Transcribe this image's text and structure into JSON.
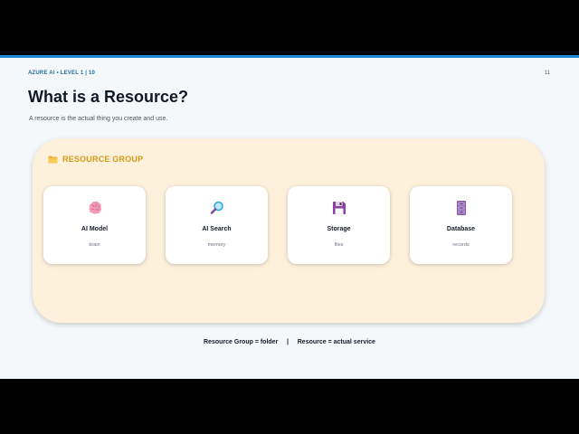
{
  "header": {
    "eyebrow": "AZURE AI • LEVEL 1 | 10",
    "page_number": "11"
  },
  "title": "What is a Resource?",
  "subtitle": "A resource is the actual thing you create and use.",
  "resource_group": {
    "label": "RESOURCE GROUP",
    "icon": "folder-icon",
    "cards": [
      {
        "title": "AI Model",
        "desc": "brain",
        "icon": "brain-icon"
      },
      {
        "title": "AI Search",
        "desc": "memory",
        "icon": "magnifying-glass-icon"
      },
      {
        "title": "Storage",
        "desc": "files",
        "icon": "floppy-disk-icon"
      },
      {
        "title": "Database",
        "desc": "records",
        "icon": "file-cabinet-icon"
      }
    ]
  },
  "footer": {
    "left": "Resource Group = folder",
    "separator": "|",
    "right": "Resource = actual service"
  },
  "colors": {
    "accent_bar": "#1f88d8",
    "group_background": "#fdf1db",
    "group_label": "#d69a1a",
    "eyebrow": "#1f6f9c"
  }
}
